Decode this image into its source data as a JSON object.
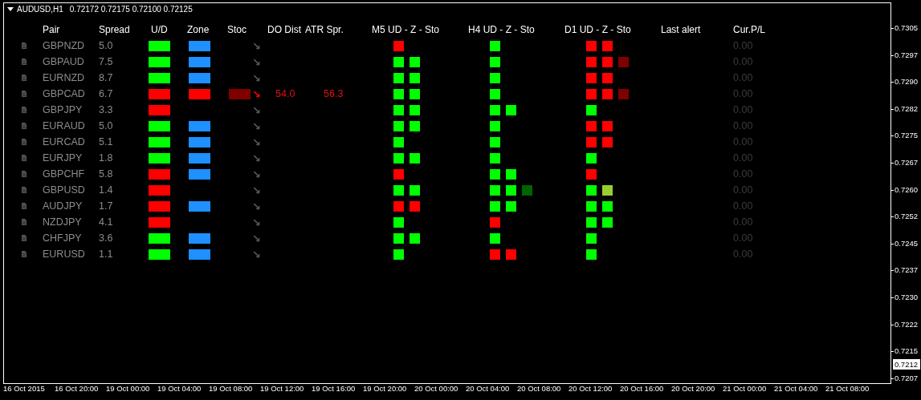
{
  "chart_header": {
    "symbol": "AUDUSD,H1",
    "ohlc": "0.72172 0.72175 0.72100 0.72125"
  },
  "columns": [
    "Pair",
    "Spread",
    "U/D",
    "Zone",
    "Stoc",
    "DO Dist",
    "ATR Spr.",
    "M5 UD - Z - Sto",
    "H4 UD - Z - Sto",
    "D1 UD - Z - Sto",
    "Last alert",
    "Cur.P/L"
  ],
  "rows": [
    {
      "pair": "GBPNZD",
      "spread": "5.0",
      "ud": {
        "color": "#00ff00"
      },
      "zone": {
        "color": "#1e90ff"
      },
      "stoc": {
        "arrow": "↘",
        "color": "#5a5a5a"
      },
      "m5": [
        {
          "color": "#ff0000"
        }
      ],
      "h4": [
        {
          "color": "#00ff00"
        }
      ],
      "d1": [
        {
          "color": "#ff0000"
        },
        {
          "color": "#ff0000"
        }
      ],
      "pl": "0.00"
    },
    {
      "pair": "GBPAUD",
      "spread": "7.5",
      "ud": {
        "color": "#00ff00"
      },
      "zone": {
        "color": "#1e90ff"
      },
      "stoc": {
        "arrow": "↘",
        "color": "#5a5a5a"
      },
      "m5": [
        {
          "color": "#00ff00"
        },
        {
          "color": "#00ff00"
        }
      ],
      "h4": [
        {
          "color": "#00ff00"
        }
      ],
      "d1": [
        {
          "color": "#ff0000"
        },
        {
          "color": "#ff0000"
        },
        {
          "color": "#800000"
        }
      ],
      "pl": "0.00"
    },
    {
      "pair": "EURNZD",
      "spread": "8.7",
      "ud": {
        "color": "#00ff00"
      },
      "zone": {
        "color": "#1e90ff"
      },
      "stoc": {
        "arrow": "↘",
        "color": "#5a5a5a"
      },
      "m5": [
        {
          "color": "#00ff00"
        },
        {
          "color": "#00ff00"
        }
      ],
      "h4": [
        {
          "color": "#00ff00"
        }
      ],
      "d1": [
        {
          "color": "#ff0000"
        },
        {
          "color": "#ff0000"
        }
      ],
      "pl": "0.00"
    },
    {
      "pair": "GBPCAD",
      "spread": "6.7",
      "ud": {
        "color": "#ff0000"
      },
      "zone": {
        "color": "#ff0000"
      },
      "stoc_bar": {
        "color": "#800000"
      },
      "stoc": {
        "arrow": "↘",
        "color": "#ff0000"
      },
      "do_dist": "54.0",
      "atr_spr": "56.3",
      "m5": [
        {
          "color": "#00ff00"
        },
        {
          "color": "#00ff00"
        }
      ],
      "h4": [
        {
          "color": "#00ff00"
        }
      ],
      "d1": [
        {
          "color": "#ff0000"
        },
        {
          "color": "#ff0000"
        },
        {
          "color": "#800000"
        }
      ],
      "pl": "0.00"
    },
    {
      "pair": "GBPJPY",
      "spread": "3.3",
      "ud": {
        "color": "#ff0000"
      },
      "stoc": {
        "arrow": "↘",
        "color": "#5a5a5a"
      },
      "m5": [
        {
          "color": "#00ff00"
        },
        {
          "color": "#00ff00"
        }
      ],
      "h4": [
        {
          "color": "#00ff00"
        },
        {
          "color": "#00ff00"
        }
      ],
      "d1": [
        {
          "color": "#00ff00"
        }
      ],
      "pl": "0.00"
    },
    {
      "pair": "EURAUD",
      "spread": "5.0",
      "ud": {
        "color": "#00ff00"
      },
      "zone": {
        "color": "#1e90ff"
      },
      "stoc": {
        "arrow": "↘",
        "color": "#5a5a5a"
      },
      "m5": [
        {
          "color": "#00ff00"
        },
        {
          "color": "#00ff00"
        }
      ],
      "h4": [
        {
          "color": "#00ff00"
        }
      ],
      "d1": [
        {
          "color": "#ff0000"
        },
        {
          "color": "#ff0000"
        }
      ],
      "pl": "0.00"
    },
    {
      "pair": "EURCAD",
      "spread": "5.1",
      "ud": {
        "color": "#00ff00"
      },
      "zone": {
        "color": "#1e90ff"
      },
      "stoc": {
        "arrow": "↘",
        "color": "#5a5a5a"
      },
      "m5": [
        {
          "color": "#00ff00"
        }
      ],
      "h4": [
        {
          "color": "#00ff00"
        }
      ],
      "d1": [
        {
          "color": "#ff0000"
        },
        {
          "color": "#ff0000"
        }
      ],
      "pl": "0.00"
    },
    {
      "pair": "EURJPY",
      "spread": "1.8",
      "ud": {
        "color": "#00ff00"
      },
      "zone": {
        "color": "#1e90ff"
      },
      "stoc": {
        "arrow": "↘",
        "color": "#5a5a5a"
      },
      "m5": [
        {
          "color": "#00ff00"
        },
        {
          "color": "#00ff00"
        }
      ],
      "h4": [
        {
          "color": "#00ff00"
        }
      ],
      "d1": [
        {
          "color": "#00ff00"
        }
      ],
      "pl": "0.00"
    },
    {
      "pair": "GBPCHF",
      "spread": "5.8",
      "ud": {
        "color": "#ff0000"
      },
      "zone": {
        "color": "#1e90ff"
      },
      "stoc": {
        "arrow": "↘",
        "color": "#5a5a5a"
      },
      "m5": [
        {
          "color": "#ff0000"
        }
      ],
      "h4": [
        {
          "color": "#00ff00"
        },
        {
          "color": "#00ff00"
        }
      ],
      "d1": [
        {
          "color": "#ff0000"
        }
      ],
      "pl": "0.00"
    },
    {
      "pair": "GBPUSD",
      "spread": "1.4",
      "ud": {
        "color": "#ff0000"
      },
      "stoc": {
        "arrow": "↘",
        "color": "#5a5a5a"
      },
      "m5": [
        {
          "color": "#00ff00"
        },
        {
          "color": "#00ff00"
        }
      ],
      "h4": [
        {
          "color": "#00ff00"
        },
        {
          "color": "#00ff00"
        },
        {
          "color": "#006400"
        }
      ],
      "d1": [
        {
          "color": "#00ff00"
        },
        {
          "color": "#9acd32"
        }
      ],
      "pl": "0.00"
    },
    {
      "pair": "AUDJPY",
      "spread": "1.7",
      "ud": {
        "color": "#ff0000"
      },
      "zone": {
        "color": "#1e90ff"
      },
      "stoc": {
        "arrow": "↘",
        "color": "#5a5a5a"
      },
      "m5": [
        {
          "color": "#ff0000"
        },
        {
          "color": "#ff0000"
        }
      ],
      "h4": [
        {
          "color": "#00ff00"
        },
        {
          "color": "#00ff00"
        }
      ],
      "d1": [
        {
          "color": "#00ff00"
        },
        {
          "color": "#00ff00"
        }
      ],
      "pl": "0.00"
    },
    {
      "pair": "NZDJPY",
      "spread": "4.1",
      "ud": {
        "color": "#ff0000"
      },
      "stoc": {
        "arrow": "↘",
        "color": "#5a5a5a"
      },
      "m5": [
        {
          "color": "#00ff00"
        }
      ],
      "h4": [
        {
          "color": "#ff0000"
        }
      ],
      "d1": [
        {
          "color": "#00ff00"
        },
        {
          "color": "#00ff00"
        }
      ],
      "pl": "0.00"
    },
    {
      "pair": "CHFJPY",
      "spread": "3.6",
      "ud": {
        "color": "#00ff00"
      },
      "zone": {
        "color": "#1e90ff"
      },
      "stoc": {
        "arrow": "↘",
        "color": "#5a5a5a"
      },
      "m5": [
        {
          "color": "#00ff00"
        },
        {
          "color": "#00ff00"
        }
      ],
      "h4": [
        {
          "color": "#00ff00"
        }
      ],
      "d1": [
        {
          "color": "#00ff00"
        }
      ],
      "pl": "0.00"
    },
    {
      "pair": "EURUSD",
      "spread": "1.1",
      "ud": {
        "color": "#00ff00"
      },
      "zone": {
        "color": "#1e90ff"
      },
      "stoc": {
        "arrow": "↘",
        "color": "#5a5a5a"
      },
      "m5": [
        {
          "color": "#00ff00"
        }
      ],
      "h4": [
        {
          "color": "#ff0000"
        },
        {
          "color": "#ff0000"
        }
      ],
      "d1": [
        {
          "color": "#00ff00"
        }
      ],
      "pl": "0.00"
    }
  ],
  "price_axis": [
    "0.7305",
    "0.7297",
    "0.7290",
    "0.7282",
    "0.7275",
    "0.7267",
    "0.7260",
    "0.7252",
    "0.7245",
    "0.7237",
    "0.7230",
    "0.7222",
    "0.7215",
    "0.7207"
  ],
  "current_price": "0.7212",
  "time_axis": [
    "16 Oct 2015",
    "16 Oct 20:00",
    "19 Oct 00:00",
    "19 Oct 04:00",
    "19 Oct 08:00",
    "19 Oct 12:00",
    "19 Oct 16:00",
    "19 Oct 20:00",
    "20 Oct 00:00",
    "20 Oct 04:00",
    "20 Oct 08:00",
    "20 Oct 12:00",
    "20 Oct 16:00",
    "20 Oct 20:00",
    "21 Oct 00:00",
    "21 Oct 04:00",
    "21 Oct 08:00"
  ]
}
